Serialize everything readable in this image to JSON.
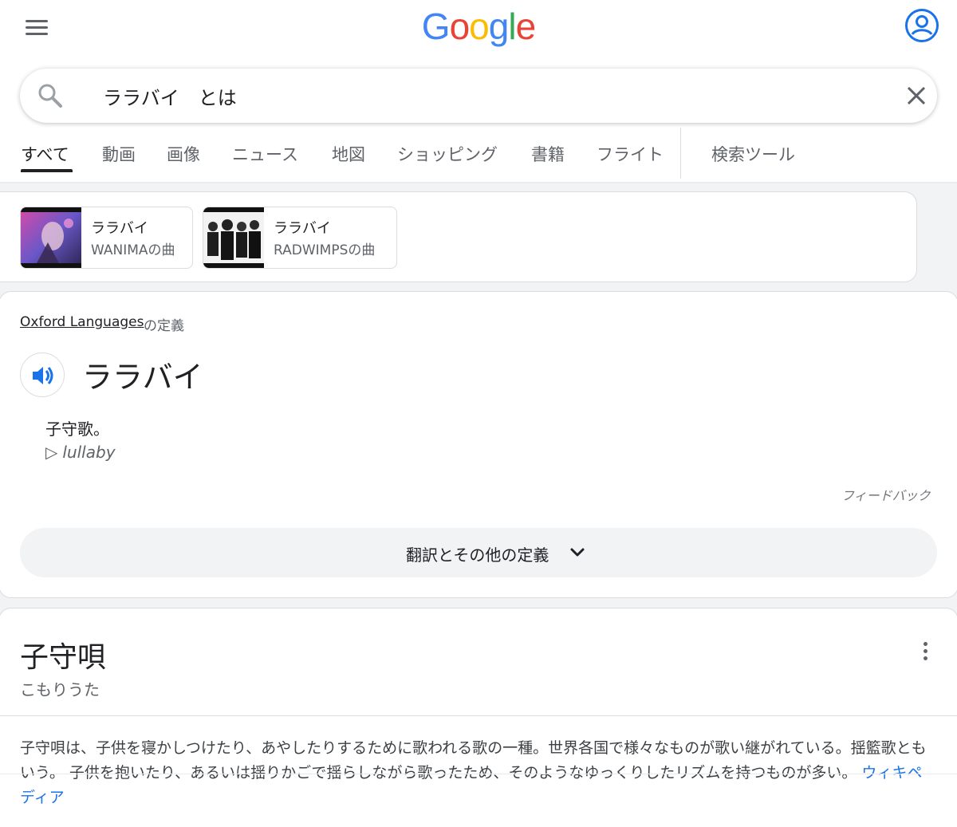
{
  "header": {
    "logo": [
      "G",
      "o",
      "o",
      "g",
      "l",
      "e"
    ],
    "logo_colors": [
      "#4285f4",
      "#ea4335",
      "#fbbc05",
      "#4285f4",
      "#34a853",
      "#ea4335"
    ],
    "menu_icon": "hamburger-menu-icon",
    "account_icon": "account-circle-icon"
  },
  "search": {
    "query": "ララバイ　とは",
    "search_icon": "search-icon",
    "clear_icon": "close-icon"
  },
  "tabs": [
    {
      "label": "すべて",
      "active": true
    },
    {
      "label": "動画"
    },
    {
      "label": "画像"
    },
    {
      "label": "ニュース"
    },
    {
      "label": "地図"
    },
    {
      "label": "ショッピング"
    },
    {
      "label": "書籍"
    },
    {
      "label": "フライト"
    },
    {
      "label": "検索ツール"
    }
  ],
  "chips": [
    {
      "title": "ララバイ",
      "subtitle": "WANIMAの曲"
    },
    {
      "title": "ララバイ",
      "subtitle": "RADWIMPSの曲"
    }
  ],
  "dictionary": {
    "source_link": "Oxford Languages",
    "source_suffix": "の定義",
    "speaker_icon": "volume-speaker-icon",
    "headword": "ララバイ",
    "definition": "子守歌。",
    "translation": "lullaby",
    "translation_icon": "play-triangle-icon",
    "feedback": "フィードバック",
    "expand_label": "翻訳とその他の定義",
    "expand_icon": "chevron-down-icon"
  },
  "knowledge_panel": {
    "title": "子守唄",
    "reading": "こもりうた",
    "menu_icon": "more-vert-icon",
    "description": "子守唄は、子供を寝かしつけたり、あやしたりするために歌われる歌の一種。世界各国で様々なものが歌い継がれている。揺籃歌ともいう。 子供を抱いたり、あるいは揺りかごで揺らしながら歌ったため、そのようなゆっくりしたリズムを持つものが多い。",
    "source_link": "ウィキペディア"
  },
  "colors": {
    "link_blue": "#1a73e8",
    "icon_blue": "#1a73e8",
    "text_primary": "#202124",
    "text_secondary": "#5f6368"
  }
}
